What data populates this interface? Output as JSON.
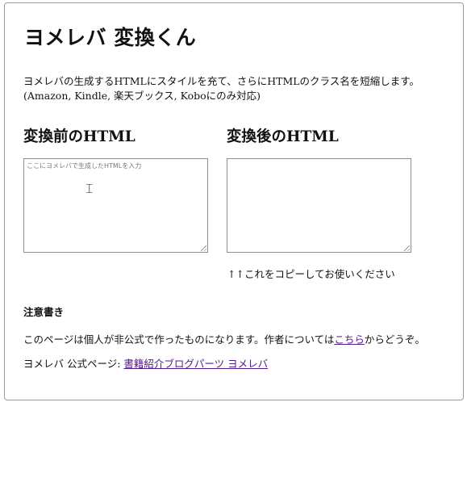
{
  "page": {
    "title": "ヨメレバ 変換くん",
    "intro": "ヨメレバの生成するHTMLにスタイルを充て、さらにHTMLのクラス名を短縮します。(Amazon, Kindle, 楽天ブックス, Koboにのみ対応)"
  },
  "input": {
    "heading": "変換前のHTML",
    "placeholder": "ここにヨメレバで生成したHTMLを入力",
    "value": ""
  },
  "output": {
    "heading": "変換後のHTML",
    "value": "",
    "copy_note": "↑↑これをコピーしてお使いください"
  },
  "notes": {
    "heading": "注意書き",
    "line1_prefix": "このページは個人が非公式で作ったものになります。作者については",
    "line1_link": "こちら",
    "line1_suffix": "からどうぞ。",
    "line2_prefix": "ヨメレバ 公式ページ: ",
    "line2_link": "書籍紹介ブログパーツ ヨメレバ"
  },
  "colors": {
    "link": "#551a8b",
    "border": "#9a9a9a",
    "placeholder": "#7b7b7b"
  },
  "icons": {
    "cursor": "text-cursor-icon",
    "resize": "resize-grip-icon"
  }
}
